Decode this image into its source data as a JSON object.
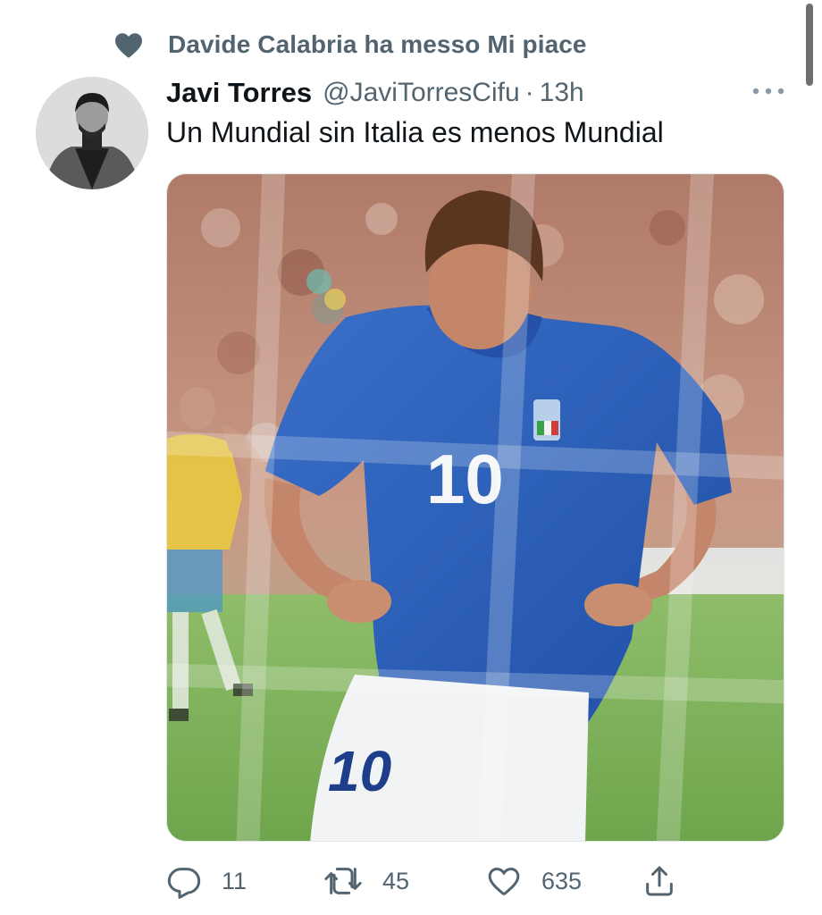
{
  "social_context": {
    "icon": "heart-filled-icon",
    "text": "Davide Calabria ha messo Mi piace"
  },
  "tweet": {
    "author_name": "Javi Torres",
    "author_handle": "@JaviTorresCifu",
    "separator": "·",
    "time": "13h",
    "text": "Un Mundial sin Italia es menos Mundial",
    "media": {
      "jersey_number_shirt": "10",
      "jersey_number_shorts": "10"
    }
  },
  "actions": {
    "reply_count": "11",
    "retweet_count": "45",
    "like_count": "635"
  },
  "colors": {
    "secondary_text": "#536471",
    "primary_text": "#0f1419",
    "heart_icon": "#536471"
  }
}
